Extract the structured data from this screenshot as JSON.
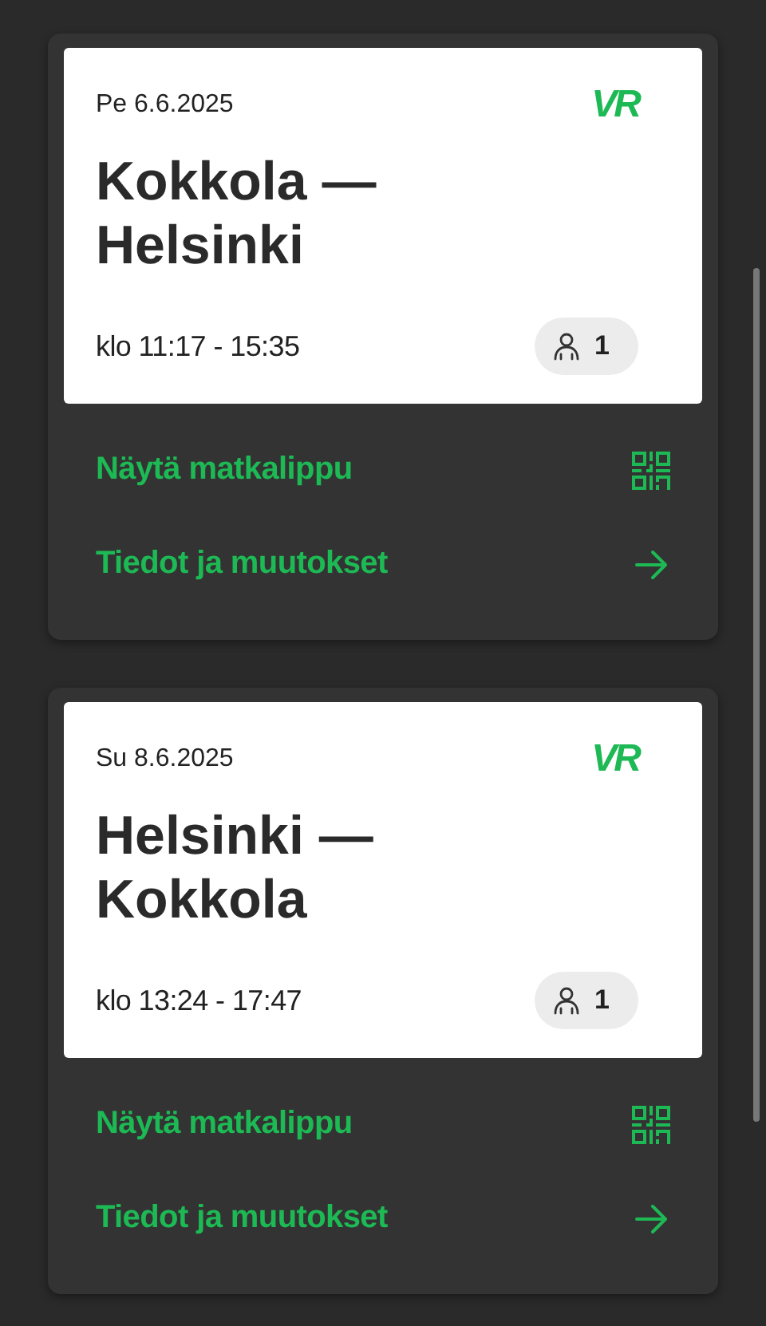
{
  "trips": [
    {
      "date": "Pe 6.6.2025",
      "logo": "VR",
      "route": "Kokkola —\nHelsinki",
      "time": "klo 11:17 - 15:35",
      "passengers": "1",
      "actions": [
        {
          "kind": "ticket",
          "label": "Näytä matkalippu"
        },
        {
          "kind": "details",
          "label": "Tiedot ja muutokset"
        }
      ]
    },
    {
      "date": "Su 8.6.2025",
      "logo": "VR",
      "route": "Helsinki —\nKokkola",
      "time": "klo 13:24 - 17:47",
      "passengers": "1",
      "actions": [
        {
          "kind": "ticket",
          "label": "Näytä matkalippu"
        },
        {
          "kind": "details",
          "label": "Tiedot ja muutokset"
        }
      ]
    }
  ]
}
